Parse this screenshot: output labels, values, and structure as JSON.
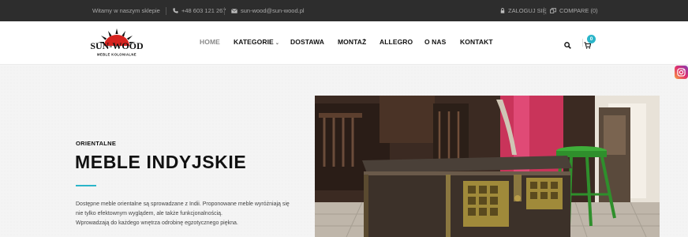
{
  "topbar": {
    "welcome": "Witamy w naszym sklepie",
    "phone": "+48 603 121 267",
    "email": "sun-wood@sun-wood.pl",
    "login": "ZALOGUJ SIĘ",
    "compare": "COMPARE (0)"
  },
  "logo": {
    "brand": "SUN-WOOD",
    "tagline": "MEBLE KOLONIALNE"
  },
  "nav": {
    "home": "HOME",
    "kategorie": "KATEGORIE",
    "dostawa": "DOSTAWA",
    "montaz": "MONTAŻ",
    "allegro": "ALLEGRO",
    "o_nas": "O NAS",
    "kontakt": "KONTAKT"
  },
  "cart": {
    "count": "0"
  },
  "hero": {
    "eyebrow": "ORIENTALNE",
    "title": "MEBLE INDYJSKIE",
    "desc_1": "Dostępne meble orientalne są sprowadzane z Indii. Proponowane meble wyróżniają się",
    "desc_2": "nie tylko efektownym wyglądem, ale także funkcjonalnością.",
    "desc_3": "Wprowadzają do każdego wnętrza odrobinę egzotycznego piękna."
  },
  "colors": {
    "accent": "#2bb5c9",
    "topbar_bg": "#2d2d2d",
    "logo_red": "#d6231f"
  }
}
